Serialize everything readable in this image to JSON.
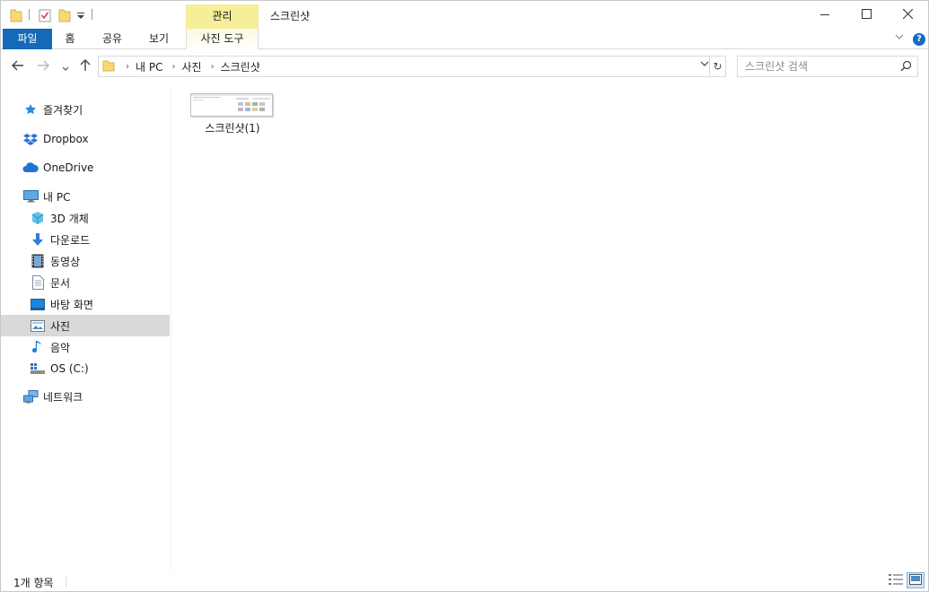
{
  "window": {
    "title": "스크린샷",
    "context_tab": "관리"
  },
  "ribbon": {
    "tabs": [
      "파일",
      "홈",
      "공유",
      "보기"
    ],
    "tool_tab": "사진 도구"
  },
  "address": {
    "crumbs": [
      "내 PC",
      "사진",
      "스크린샷"
    ]
  },
  "search": {
    "placeholder": "스크린샷 검색"
  },
  "nav": {
    "quick_access": "즐겨찾기",
    "dropbox": "Dropbox",
    "onedrive": "OneDrive",
    "this_pc": "내 PC",
    "pc_items": [
      "3D 개체",
      "다운로드",
      "동영상",
      "문서",
      "바탕 화면",
      "사진",
      "음악",
      "OS (C:)"
    ],
    "network": "네트워크",
    "selected": "사진"
  },
  "files": [
    {
      "name": "스크린샷(1)"
    }
  ],
  "status": {
    "count_text": "1개 항목"
  },
  "colors": {
    "file_tab": "#1668b8",
    "manage_tab": "#f6ee98",
    "selected_nav": "#d9d9d9",
    "active_view": "#cce4f7"
  }
}
